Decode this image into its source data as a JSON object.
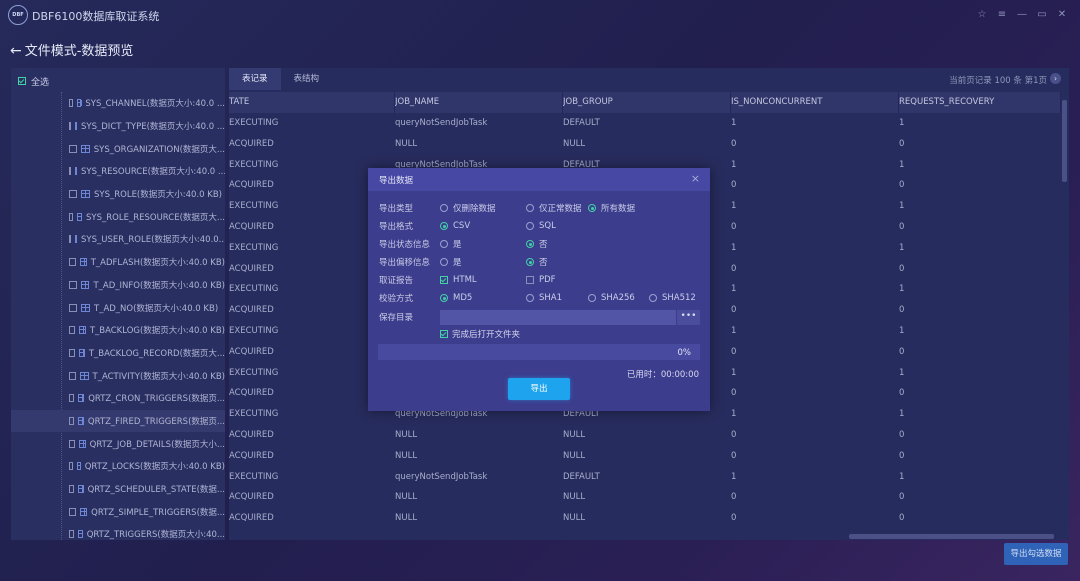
{
  "app": {
    "logo_text": "DBF",
    "title": "DBF6100数据库取证系统"
  },
  "window_controls": [
    "☆",
    "≡",
    "—",
    "▭",
    "✕"
  ],
  "page": {
    "back_icon": "←",
    "title": "文件模式-数据预览"
  },
  "tree": {
    "select_all_label": "全选",
    "items": [
      {
        "label": "SYS_CHANNEL(数据页大小:40.0 ..."
      },
      {
        "label": "SYS_DICT_TYPE(数据页大小:40.0 ..."
      },
      {
        "label": "SYS_ORGANIZATION(数据页大..."
      },
      {
        "label": "SYS_RESOURCE(数据页大小:40.0 ..."
      },
      {
        "label": "SYS_ROLE(数据页大小:40.0 KB)"
      },
      {
        "label": "SYS_ROLE_RESOURCE(数据页大..."
      },
      {
        "label": "SYS_USER_ROLE(数据页大小:40.0..."
      },
      {
        "label": "T_ADFLASH(数据页大小:40.0 KB)"
      },
      {
        "label": "T_AD_INFO(数据页大小:40.0 KB)"
      },
      {
        "label": "T_AD_NO(数据页大小:40.0 KB)"
      },
      {
        "label": "T_BACKLOG(数据页大小:40.0 KB)"
      },
      {
        "label": "T_BACKLOG_RECORD(数据页大..."
      },
      {
        "label": "T_ACTIVITY(数据页大小:40.0 KB)"
      },
      {
        "label": "QRTZ_CRON_TRIGGERS(数据页..."
      },
      {
        "label": "QRTZ_FIRED_TRIGGERS(数据页...",
        "selected": true
      },
      {
        "label": "QRTZ_JOB_DETAILS(数据页大小..."
      },
      {
        "label": "QRTZ_LOCKS(数据页大小:40.0 KB)"
      },
      {
        "label": "QRTZ_SCHEDULER_STATE(数据..."
      },
      {
        "label": "QRTZ_SIMPLE_TRIGGERS(数据..."
      },
      {
        "label": "QRTZ_TRIGGERS(数据页大小:40..."
      }
    ]
  },
  "tabs": [
    {
      "label": "表记录",
      "active": true
    },
    {
      "label": "表结构",
      "active": false
    }
  ],
  "pagination": {
    "info": "当前页记录 100 条   第1页",
    "next_icon": "›"
  },
  "table": {
    "columns": [
      "TATE",
      "JOB_NAME",
      "JOB_GROUP",
      "IS_NONCONCURRENT",
      "REQUESTS_RECOVERY"
    ],
    "rows": [
      [
        "EXECUTING",
        "queryNotSendJobTask",
        "DEFAULT",
        "1",
        "1"
      ],
      [
        "ACQUIRED",
        "NULL",
        "NULL",
        "0",
        "0"
      ],
      [
        "EXECUTING",
        "queryNotSendJobTask",
        "DEFAULT",
        "1",
        "1"
      ],
      [
        "ACQUIRED",
        "",
        "",
        "0",
        "0"
      ],
      [
        "EXECUTING",
        "",
        "",
        "1",
        "1"
      ],
      [
        "ACQUIRED",
        "",
        "",
        "0",
        "0"
      ],
      [
        "EXECUTING",
        "",
        "",
        "1",
        "1"
      ],
      [
        "ACQUIRED",
        "",
        "",
        "0",
        "0"
      ],
      [
        "EXECUTING",
        "",
        "",
        "1",
        "1"
      ],
      [
        "ACQUIRED",
        "",
        "",
        "0",
        "0"
      ],
      [
        "EXECUTING",
        "",
        "",
        "1",
        "1"
      ],
      [
        "ACQUIRED",
        "",
        "",
        "0",
        "0"
      ],
      [
        "EXECUTING",
        "",
        "",
        "1",
        "1"
      ],
      [
        "ACQUIRED",
        "",
        "",
        "0",
        "0"
      ],
      [
        "EXECUTING",
        "queryNotSendJobTask",
        "DEFAULT",
        "1",
        "1"
      ],
      [
        "ACQUIRED",
        "NULL",
        "NULL",
        "0",
        "0"
      ],
      [
        "ACQUIRED",
        "NULL",
        "NULL",
        "0",
        "0"
      ],
      [
        "EXECUTING",
        "queryNotSendJobTask",
        "DEFAULT",
        "1",
        "1"
      ],
      [
        "ACQUIRED",
        "NULL",
        "NULL",
        "0",
        "0"
      ],
      [
        "ACQUIRED",
        "NULL",
        "NULL",
        "0",
        "0"
      ]
    ]
  },
  "export_selected_label": "导出勾选数据",
  "dialog": {
    "title": "导出数据",
    "close_icon": "×",
    "export_type": {
      "label": "导出类型",
      "options": [
        {
          "label": "仅删除数据",
          "on": false
        },
        {
          "label": "仅正常数据",
          "on": false
        },
        {
          "label": "所有数据",
          "on": true
        }
      ]
    },
    "export_format": {
      "label": "导出格式",
      "options": [
        {
          "label": "CSV",
          "on": true
        },
        {
          "label": "SQL",
          "on": false
        }
      ]
    },
    "export_status": {
      "label": "导出状态信息",
      "options": [
        {
          "label": "是",
          "on": false
        },
        {
          "label": "否",
          "on": true
        }
      ]
    },
    "export_offset": {
      "label": "导出偏移信息",
      "options": [
        {
          "label": "是",
          "on": false
        },
        {
          "label": "否",
          "on": true
        }
      ]
    },
    "report": {
      "label": "取证报告",
      "options": [
        {
          "label": "HTML",
          "on": true
        },
        {
          "label": "PDF",
          "on": false
        }
      ]
    },
    "checksum": {
      "label": "校验方式",
      "options": [
        {
          "label": "MD5",
          "on": true
        },
        {
          "label": "SHA1",
          "on": false
        },
        {
          "label": "SHA256",
          "on": false
        },
        {
          "label": "SHA512",
          "on": false
        }
      ]
    },
    "save_dir": {
      "label": "保存目录",
      "value": "",
      "browse_icon": "•••"
    },
    "open_folder": {
      "label": "完成后打开文件夹",
      "checked": true
    },
    "progress": {
      "percent": 0,
      "text": "0%"
    },
    "elapsed": "已用时：00:00:00",
    "export_button": "导出"
  },
  "colors": {
    "accent": "#43d1a6",
    "primary_button": "#1ea4ee",
    "dialog_bg": "#3d3d8e"
  }
}
